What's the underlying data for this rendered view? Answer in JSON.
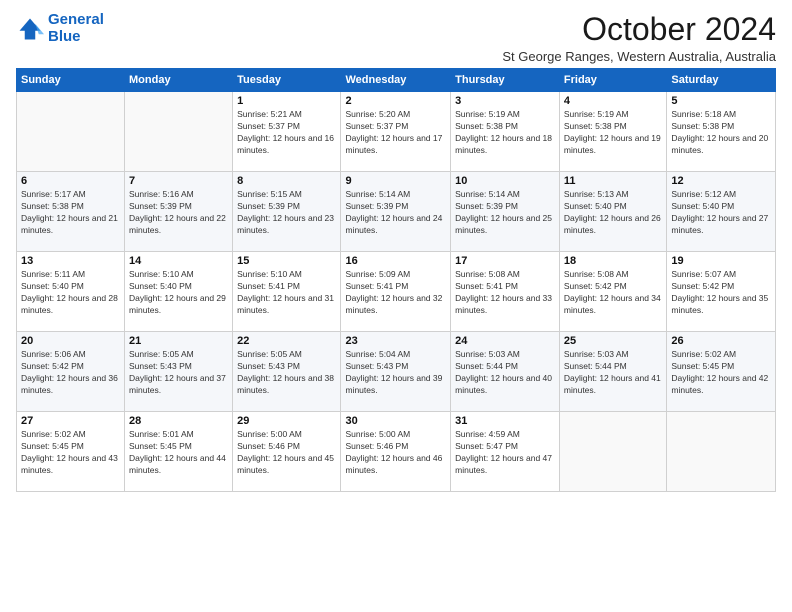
{
  "logo": {
    "line1": "General",
    "line2": "Blue"
  },
  "title": "October 2024",
  "subtitle": "St George Ranges, Western Australia, Australia",
  "days_of_week": [
    "Sunday",
    "Monday",
    "Tuesday",
    "Wednesday",
    "Thursday",
    "Friday",
    "Saturday"
  ],
  "weeks": [
    [
      {
        "day": "",
        "info": ""
      },
      {
        "day": "",
        "info": ""
      },
      {
        "day": "1",
        "info": "Sunrise: 5:21 AM\nSunset: 5:37 PM\nDaylight: 12 hours and 16 minutes."
      },
      {
        "day": "2",
        "info": "Sunrise: 5:20 AM\nSunset: 5:37 PM\nDaylight: 12 hours and 17 minutes."
      },
      {
        "day": "3",
        "info": "Sunrise: 5:19 AM\nSunset: 5:38 PM\nDaylight: 12 hours and 18 minutes."
      },
      {
        "day": "4",
        "info": "Sunrise: 5:19 AM\nSunset: 5:38 PM\nDaylight: 12 hours and 19 minutes."
      },
      {
        "day": "5",
        "info": "Sunrise: 5:18 AM\nSunset: 5:38 PM\nDaylight: 12 hours and 20 minutes."
      }
    ],
    [
      {
        "day": "6",
        "info": "Sunrise: 5:17 AM\nSunset: 5:38 PM\nDaylight: 12 hours and 21 minutes."
      },
      {
        "day": "7",
        "info": "Sunrise: 5:16 AM\nSunset: 5:39 PM\nDaylight: 12 hours and 22 minutes."
      },
      {
        "day": "8",
        "info": "Sunrise: 5:15 AM\nSunset: 5:39 PM\nDaylight: 12 hours and 23 minutes."
      },
      {
        "day": "9",
        "info": "Sunrise: 5:14 AM\nSunset: 5:39 PM\nDaylight: 12 hours and 24 minutes."
      },
      {
        "day": "10",
        "info": "Sunrise: 5:14 AM\nSunset: 5:39 PM\nDaylight: 12 hours and 25 minutes."
      },
      {
        "day": "11",
        "info": "Sunrise: 5:13 AM\nSunset: 5:40 PM\nDaylight: 12 hours and 26 minutes."
      },
      {
        "day": "12",
        "info": "Sunrise: 5:12 AM\nSunset: 5:40 PM\nDaylight: 12 hours and 27 minutes."
      }
    ],
    [
      {
        "day": "13",
        "info": "Sunrise: 5:11 AM\nSunset: 5:40 PM\nDaylight: 12 hours and 28 minutes."
      },
      {
        "day": "14",
        "info": "Sunrise: 5:10 AM\nSunset: 5:40 PM\nDaylight: 12 hours and 29 minutes."
      },
      {
        "day": "15",
        "info": "Sunrise: 5:10 AM\nSunset: 5:41 PM\nDaylight: 12 hours and 31 minutes."
      },
      {
        "day": "16",
        "info": "Sunrise: 5:09 AM\nSunset: 5:41 PM\nDaylight: 12 hours and 32 minutes."
      },
      {
        "day": "17",
        "info": "Sunrise: 5:08 AM\nSunset: 5:41 PM\nDaylight: 12 hours and 33 minutes."
      },
      {
        "day": "18",
        "info": "Sunrise: 5:08 AM\nSunset: 5:42 PM\nDaylight: 12 hours and 34 minutes."
      },
      {
        "day": "19",
        "info": "Sunrise: 5:07 AM\nSunset: 5:42 PM\nDaylight: 12 hours and 35 minutes."
      }
    ],
    [
      {
        "day": "20",
        "info": "Sunrise: 5:06 AM\nSunset: 5:42 PM\nDaylight: 12 hours and 36 minutes."
      },
      {
        "day": "21",
        "info": "Sunrise: 5:05 AM\nSunset: 5:43 PM\nDaylight: 12 hours and 37 minutes."
      },
      {
        "day": "22",
        "info": "Sunrise: 5:05 AM\nSunset: 5:43 PM\nDaylight: 12 hours and 38 minutes."
      },
      {
        "day": "23",
        "info": "Sunrise: 5:04 AM\nSunset: 5:43 PM\nDaylight: 12 hours and 39 minutes."
      },
      {
        "day": "24",
        "info": "Sunrise: 5:03 AM\nSunset: 5:44 PM\nDaylight: 12 hours and 40 minutes."
      },
      {
        "day": "25",
        "info": "Sunrise: 5:03 AM\nSunset: 5:44 PM\nDaylight: 12 hours and 41 minutes."
      },
      {
        "day": "26",
        "info": "Sunrise: 5:02 AM\nSunset: 5:45 PM\nDaylight: 12 hours and 42 minutes."
      }
    ],
    [
      {
        "day": "27",
        "info": "Sunrise: 5:02 AM\nSunset: 5:45 PM\nDaylight: 12 hours and 43 minutes."
      },
      {
        "day": "28",
        "info": "Sunrise: 5:01 AM\nSunset: 5:45 PM\nDaylight: 12 hours and 44 minutes."
      },
      {
        "day": "29",
        "info": "Sunrise: 5:00 AM\nSunset: 5:46 PM\nDaylight: 12 hours and 45 minutes."
      },
      {
        "day": "30",
        "info": "Sunrise: 5:00 AM\nSunset: 5:46 PM\nDaylight: 12 hours and 46 minutes."
      },
      {
        "day": "31",
        "info": "Sunrise: 4:59 AM\nSunset: 5:47 PM\nDaylight: 12 hours and 47 minutes."
      },
      {
        "day": "",
        "info": ""
      },
      {
        "day": "",
        "info": ""
      }
    ]
  ]
}
